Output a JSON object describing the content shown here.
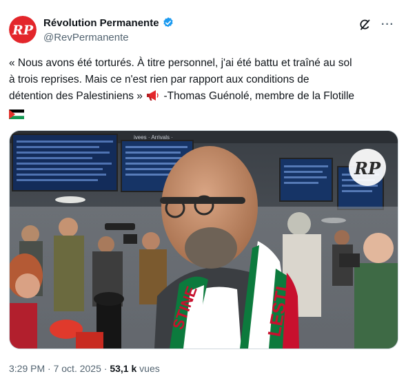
{
  "author": {
    "display_name": "Révolution Permanente",
    "handle": "@RevPermanente",
    "avatar_letters": "RP",
    "brand_color": "#e3262b",
    "verified_color": "#1d9bf0"
  },
  "actions": {
    "grok_icon": "grok-icon",
    "more_label": "···"
  },
  "tweet": {
    "line1": "« Nous avons été torturés. À titre personnel, j'ai été battu et traîné au sol",
    "line2": "à trois reprises. Mais ce n'est rien par rapport aux conditions de",
    "line3_before_icon": "détention des Palestiniens » ",
    "line3_after_icon": " -Thomas Guénolé, membre de la Flotille",
    "megaphone_icon": "megaphone-icon",
    "flag_icon": "palestine-flag-icon"
  },
  "media": {
    "type": "video",
    "watermark_letters": "RP",
    "board_text": "ivees · Arrivals ·",
    "scarf_text_left": "STINE",
    "scarf_text_right": "LESTI"
  },
  "meta": {
    "time": "3:29 PM",
    "separator": " · ",
    "date": "7 oct. 2025",
    "views_count": "53,1 k",
    "views_label": " vues"
  }
}
